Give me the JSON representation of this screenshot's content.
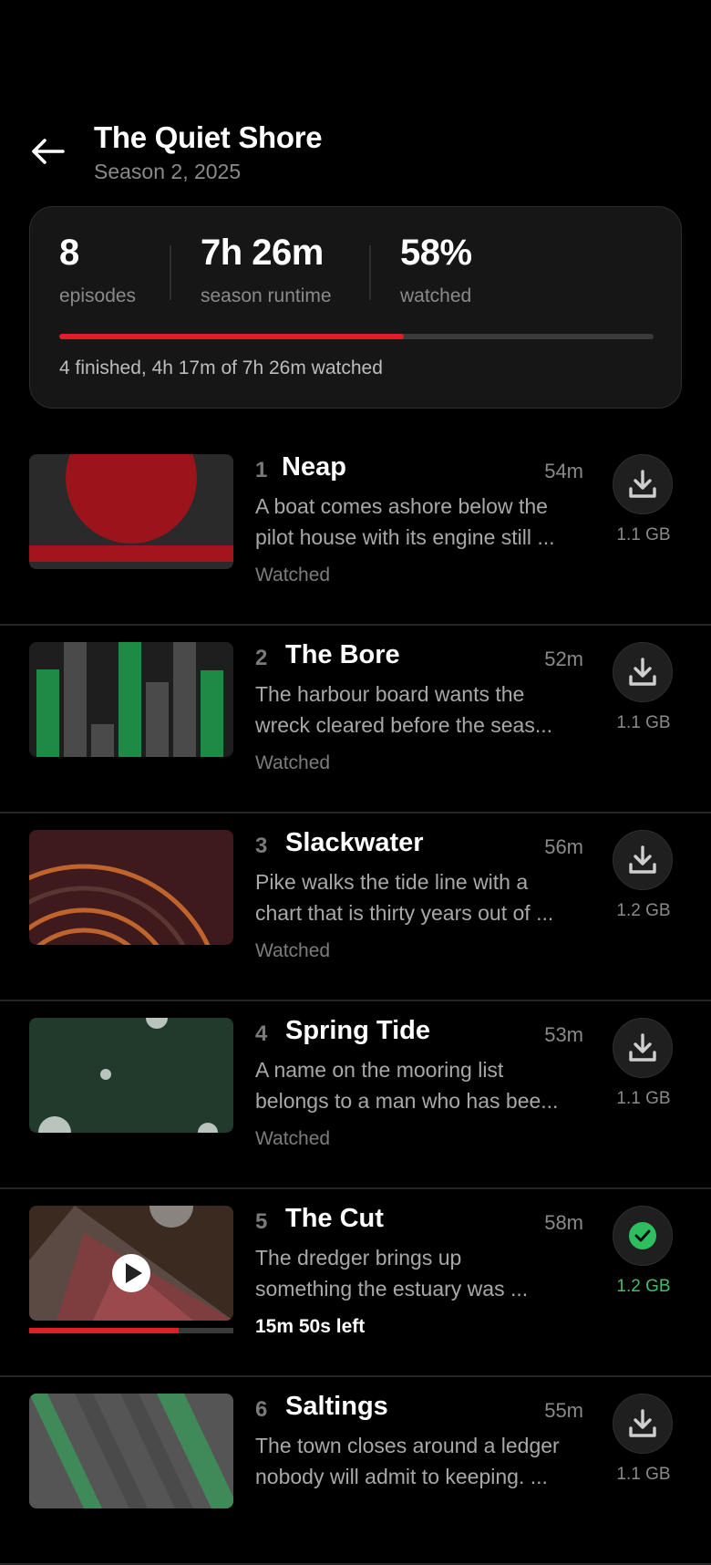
{
  "header": {
    "title": "The Quiet Shore",
    "subtitle": "Season 2, 2025",
    "back_icon": "arrow-left-icon"
  },
  "stats": {
    "episodes_value": "8",
    "episodes_label": "episodes",
    "runtime_value": "7h 26m",
    "runtime_label": "season runtime",
    "watched_value": "58%",
    "watched_label": "watched",
    "progress_fraction": 0.58,
    "summary": "4 finished, 4h 17m of 7h 26m watched"
  },
  "colors": {
    "accent_red": "#e01e26",
    "downloaded_green": "#3fbf6a",
    "background": "#000000",
    "card": "#161616"
  },
  "episodes": [
    {
      "number": "1",
      "title": "Neap",
      "duration": "54m",
      "desc_line1": "A boat comes ashore below the",
      "desc_line2": "pilot house with its engine still ...",
      "status": "Watched",
      "size": "1.1 GB",
      "download_icon": "download-icon",
      "downloaded": false
    },
    {
      "number": "2",
      "title": "The Bore",
      "duration": "52m",
      "desc_line1": "The harbour board wants the",
      "desc_line2": "wreck cleared before the seas...",
      "status": "Watched",
      "size": "1.1 GB",
      "download_icon": "download-icon",
      "downloaded": false
    },
    {
      "number": "3",
      "title": "Slackwater",
      "duration": "56m",
      "desc_line1": "Pike walks the tide line with a",
      "desc_line2": "chart that is thirty years out of ...",
      "status": "Watched",
      "size": "1.2 GB",
      "download_icon": "download-icon",
      "downloaded": false
    },
    {
      "number": "4",
      "title": "Spring Tide",
      "duration": "53m",
      "desc_line1": "A name on the mooring list",
      "desc_line2": "belongs to a man who has bee...",
      "status": "Watched",
      "size": "1.1 GB",
      "download_icon": "download-icon",
      "downloaded": false
    },
    {
      "number": "5",
      "title": "The Cut",
      "duration": "58m",
      "desc_line1": "The dredger brings up",
      "desc_line2": "something the estuary was ...",
      "status": "15m 50s left",
      "size": "1.2 GB",
      "download_icon": "check-circle-icon",
      "downloaded": true,
      "play_icon": "play-icon",
      "progress_fraction": 0.73
    },
    {
      "number": "6",
      "title": "Saltings",
      "duration": "55m",
      "desc_line1": "The town closes around a ledger",
      "desc_line2": "nobody will admit to keeping. ...",
      "status": "",
      "size": "1.1 GB",
      "download_icon": "download-icon",
      "downloaded": false
    }
  ]
}
